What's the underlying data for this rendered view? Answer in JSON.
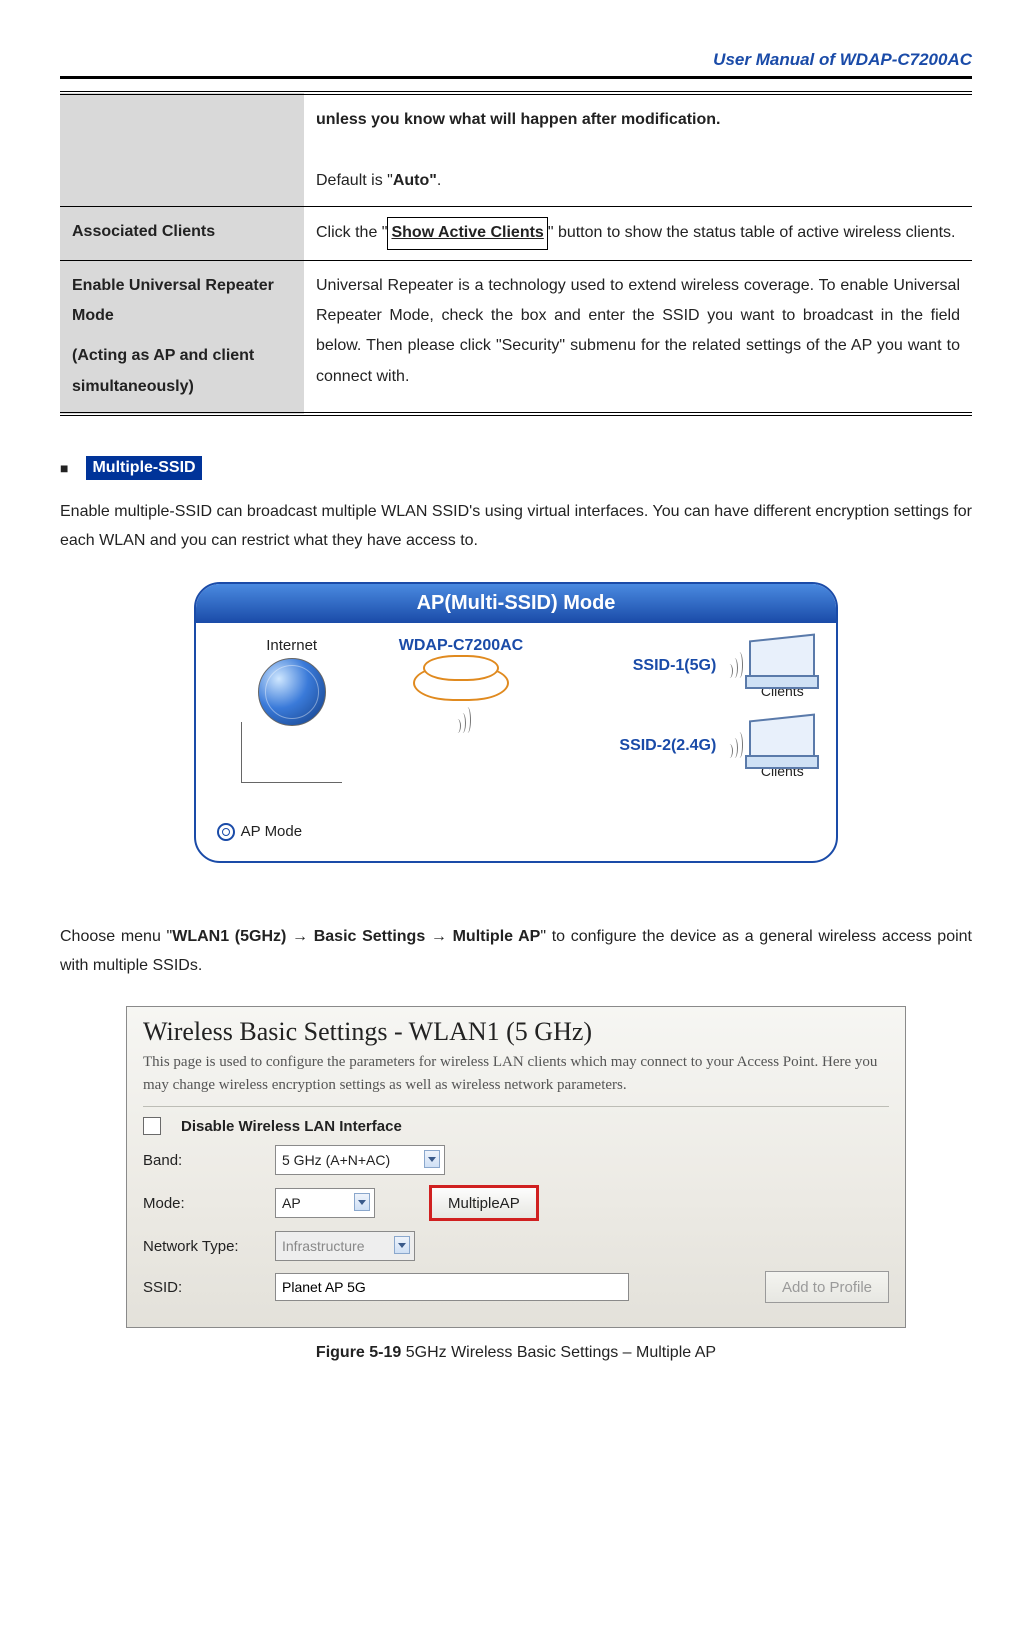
{
  "header": {
    "title": "User Manual of WDAP-C7200AC"
  },
  "table": {
    "rows": [
      {
        "left": "",
        "right_pre_bold": "unless you know what will happen after modification.",
        "right_plain_a": "Default is \"",
        "right_bold_a": "Auto\"",
        "right_plain_b": "."
      },
      {
        "left": "Associated Clients",
        "right_plain_a": "Click the \"",
        "right_button": "Show Active Clients",
        "right_plain_b": "\" button to show the status table of active wireless clients."
      },
      {
        "left_line1": "Enable Universal Repeater Mode",
        "left_line2": "(Acting as AP and client simultaneously)",
        "right": "Universal Repeater is a technology used to extend wireless coverage. To enable Universal Repeater Mode, check the box and enter the SSID you want to broadcast in the field below. Then please click \"Security\" submenu for the related settings of the AP you want to connect with."
      }
    ]
  },
  "section": {
    "badge": "Multiple-SSID",
    "intro": "Enable multiple-SSID can broadcast multiple WLAN SSID's using virtual interfaces. You can have different encryption settings for each WLAN and you can restrict what they have access to."
  },
  "diagram": {
    "title": "AP(Multi-SSID) Mode",
    "internet": "Internet",
    "device": "WDAP-C7200AC",
    "ssid1": "SSID-1(5G)",
    "ssid2": "SSID-2(2.4G)",
    "clients": "Clients",
    "ap_mode": "AP Mode"
  },
  "body2_a": "Choose menu \"",
  "body2_bold": "WLAN1 (5GHz) → Basic Settings → Multiple AP",
  "body2_b": "\" to configure the device as a general wireless access point with multiple SSIDs.",
  "shot": {
    "title": "Wireless Basic Settings - WLAN1 (5 GHz)",
    "sub": "This page is used to configure the parameters for wireless LAN clients which may connect to your Access Point. Here you may change wireless encryption settings as well as wireless network parameters.",
    "disable": "Disable Wireless LAN Interface",
    "band_label": "Band:",
    "band_value": "5 GHz (A+N+AC)",
    "mode_label": "Mode:",
    "mode_value": "AP",
    "multiple_btn": "MultipleAP",
    "nt_label": "Network Type:",
    "nt_value": "Infrastructure",
    "ssid_label": "SSID:",
    "ssid_value": "Planet AP 5G",
    "add_profile": "Add to Profile"
  },
  "caption_bold": "Figure 5-19",
  "caption_rest": " 5GHz Wireless Basic Settings – Multiple AP"
}
